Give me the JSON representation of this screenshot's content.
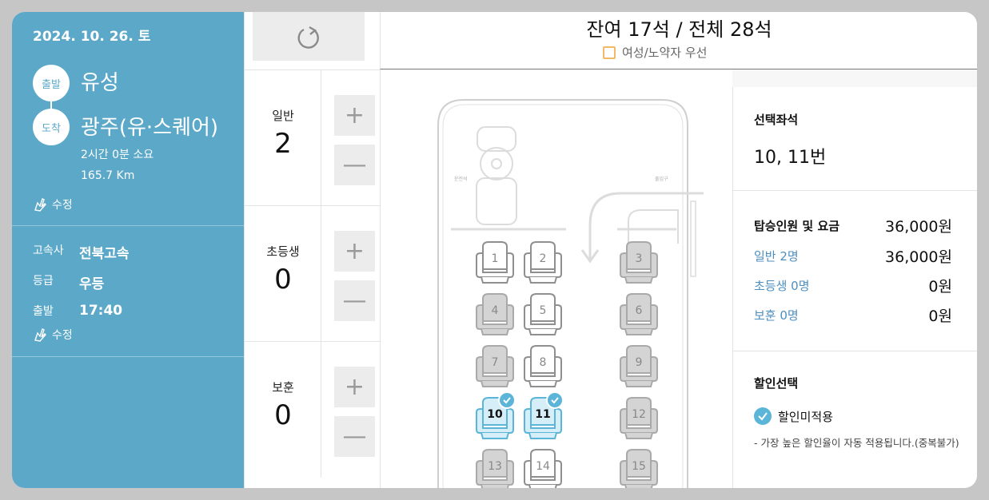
{
  "trip": {
    "date": "2024. 10. 26. 토",
    "depart_badge": "출발",
    "depart_place": "유성",
    "arrive_badge": "도착",
    "arrive_place": "광주(유·스퀘어)",
    "duration": "2시간 0분 소요",
    "distance": "165.7 Km",
    "edit_label": "수정"
  },
  "details": {
    "company_label": "고속사",
    "company": "전북고속",
    "grade_label": "등급",
    "grade": "우등",
    "time_label": "출발",
    "time": "17:40",
    "edit_label": "수정"
  },
  "counters": [
    {
      "label": "일반",
      "value": "2"
    },
    {
      "label": "초등생",
      "value": "0"
    },
    {
      "label": "보훈",
      "value": "0"
    }
  ],
  "header": {
    "title": "잔여 17석 / 전체 28석",
    "priority_label": "여성/노약자 우선"
  },
  "seats": [
    {
      "num": "1",
      "selected": false
    },
    {
      "num": "2",
      "selected": false
    },
    {
      "num": "3",
      "selected": false
    },
    {
      "num": "4",
      "selected": false
    },
    {
      "num": "5",
      "selected": false
    },
    {
      "num": "6",
      "selected": false
    },
    {
      "num": "7",
      "selected": false
    },
    {
      "num": "8",
      "selected": false
    },
    {
      "num": "9",
      "selected": false
    },
    {
      "num": "10",
      "selected": true
    },
    {
      "num": "11",
      "selected": true
    },
    {
      "num": "12",
      "selected": false
    },
    {
      "num": "13",
      "selected": false
    },
    {
      "num": "14",
      "selected": false
    },
    {
      "num": "15",
      "selected": false
    }
  ],
  "seat_status": {
    "1": "available",
    "2": "available",
    "3": "taken",
    "4": "taken",
    "5": "available",
    "6": "taken",
    "7": "taken",
    "8": "available",
    "9": "taken",
    "10": "selected",
    "11": "selected",
    "12": "taken",
    "13": "taken",
    "14": "available",
    "15": "taken"
  },
  "bus": {
    "driver_label": "운전석",
    "door_label": "출입구"
  },
  "summary": {
    "selected_title": "선택좌석",
    "selected_seats": "10, 11번",
    "fare_title": "탑승인원 및 요금",
    "total": "36,000원",
    "rows": [
      {
        "label": "일반 2명",
        "amount": "36,000원"
      },
      {
        "label": "초등생 0명",
        "amount": "0원"
      },
      {
        "label": "보훈 0명",
        "amount": "0원"
      }
    ],
    "discount_title": "할인선택",
    "discount_option": "할인미적용",
    "note": "- 가장 높은 할인율이 자동 적용됩니다.(중복불가)"
  },
  "colors": {
    "panel": "#5ba8c9",
    "accent_blue": "#5bb5d9",
    "link_blue": "#4d8fbf",
    "priority_orange": "#f3b868"
  }
}
